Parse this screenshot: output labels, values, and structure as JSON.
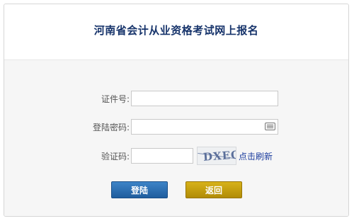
{
  "form": {
    "title": "河南省会计从业资格考试网上报名",
    "fields": {
      "id_label": "证件号:",
      "id_value": "",
      "password_label": "登陆密码:",
      "password_value": "",
      "captcha_label": "验证码:",
      "captcha_value": "",
      "captcha_image_text": "DXEO",
      "refresh_link": "点击刷新"
    },
    "buttons": {
      "login": "登陆",
      "back": "返回"
    }
  },
  "colors": {
    "title": "#17346b",
    "login_button": "#2d6fb2",
    "back_button": "#c4a00f",
    "link": "#1b3c9e"
  }
}
